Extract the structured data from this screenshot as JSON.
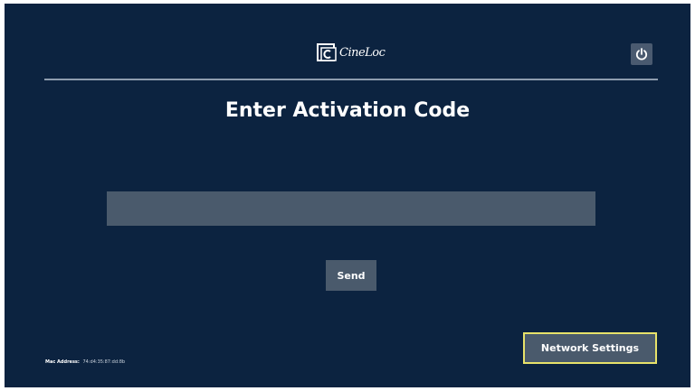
{
  "header": {
    "logo_text": "CineLoc",
    "power_icon": "power-icon"
  },
  "main": {
    "title": "Enter Activation Code",
    "code_input_value": "",
    "send_label": "Send"
  },
  "footer": {
    "mac_label": "Mac Address:",
    "mac_value": "74:d4:35:87:dd:8b",
    "network_settings_label": "Network Settings"
  },
  "colors": {
    "background": "#0c2340",
    "control": "#4a5a6c",
    "divider": "#8e9cae",
    "focus_outline": "#e8e26a",
    "text": "#ffffff"
  }
}
